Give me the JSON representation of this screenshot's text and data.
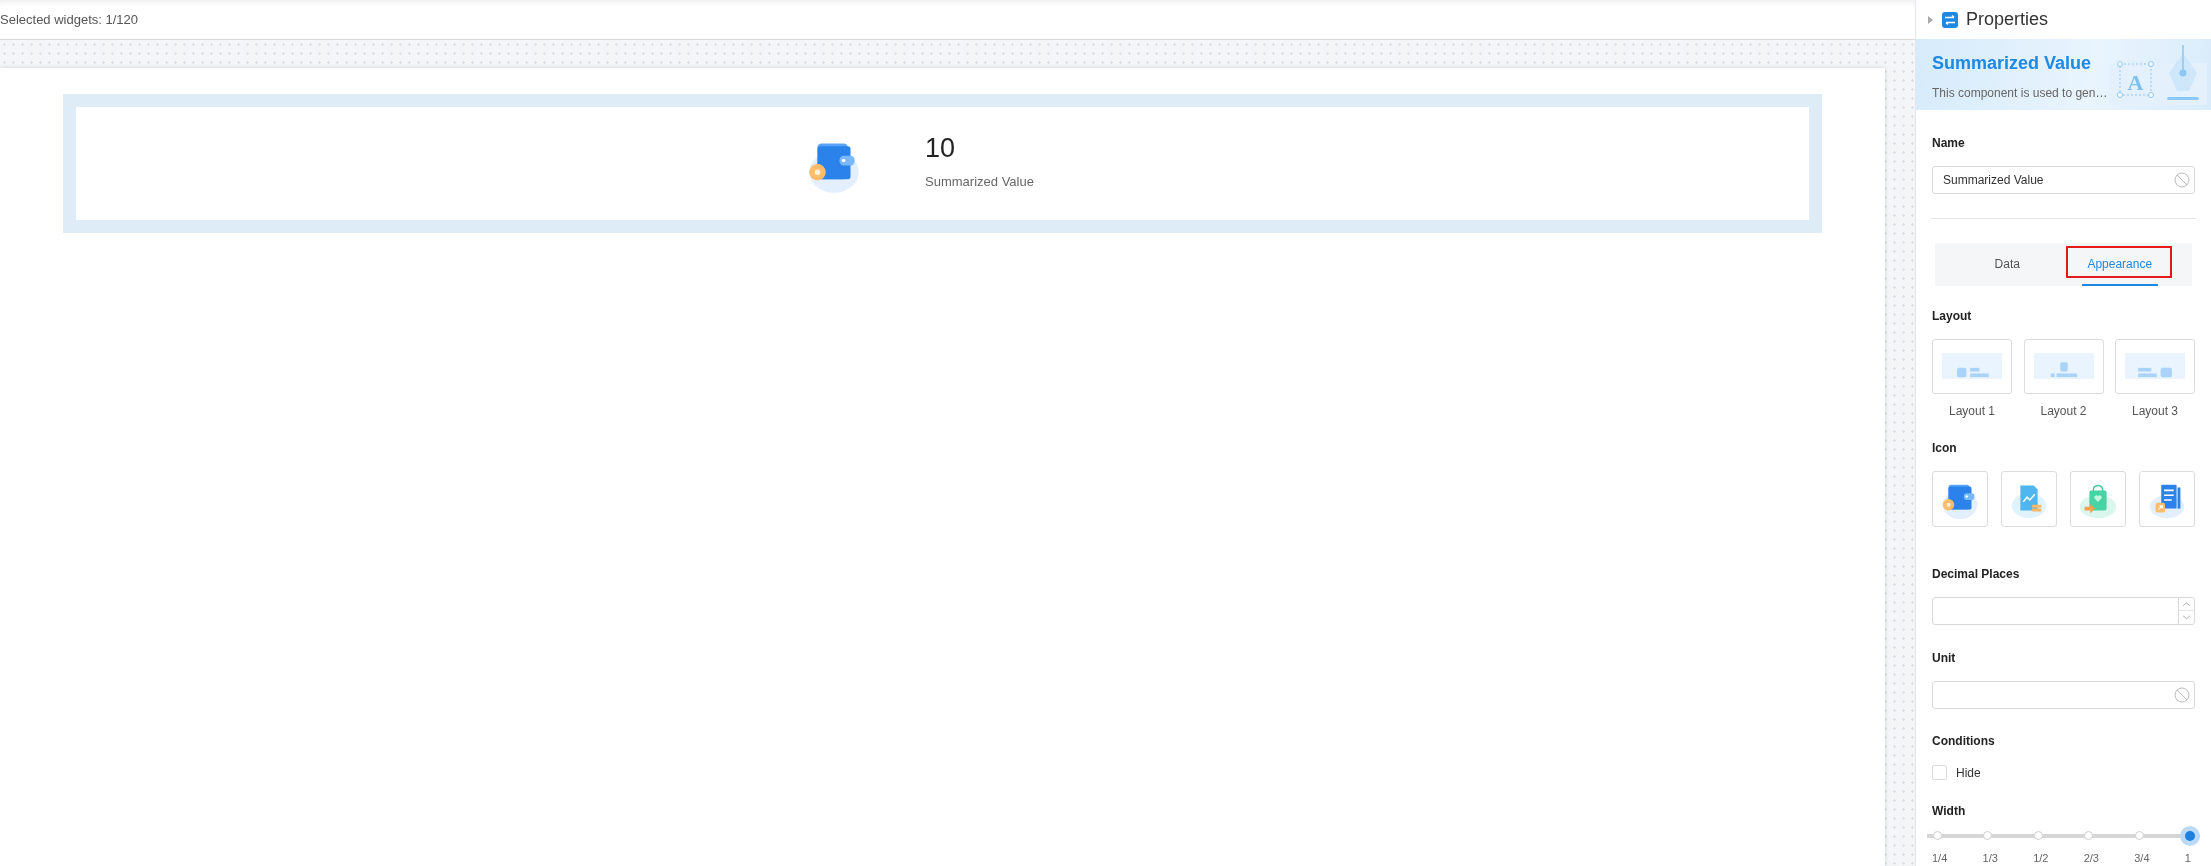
{
  "toolbar": {
    "selection_count": "Selected widgets: 1/120"
  },
  "widget": {
    "value": "10",
    "label": "Summarized Value"
  },
  "properties": {
    "title": "Properties",
    "banner": {
      "title": "Summarized Value",
      "description": "This component is used to gen…",
      "illustration_letter": "A"
    },
    "name": {
      "label": "Name",
      "value": "Summarized Value"
    },
    "tabs": [
      {
        "label": "Data",
        "selected": false,
        "highlighted": false
      },
      {
        "label": "Appearance",
        "selected": true,
        "highlighted": true
      }
    ],
    "layout": {
      "label": "Layout",
      "options": [
        {
          "label": "Layout 1",
          "kind": "left"
        },
        {
          "label": "Layout 2",
          "kind": "center"
        },
        {
          "label": "Layout 3",
          "kind": "right"
        }
      ]
    },
    "icon": {
      "label": "Icon",
      "options": [
        {
          "kind": "wallet"
        },
        {
          "kind": "chart"
        },
        {
          "kind": "bag"
        },
        {
          "kind": "document"
        }
      ]
    },
    "decimal_places": {
      "label": "Decimal Places"
    },
    "unit": {
      "label": "Unit"
    },
    "conditions": {
      "label": "Conditions",
      "hide": {
        "label": "Hide",
        "checked": false
      }
    },
    "width": {
      "label": "Width",
      "level": 1,
      "stops": [
        "1/4",
        "1/3",
        "1/2",
        "2/3",
        "3/4",
        "1"
      ]
    }
  }
}
